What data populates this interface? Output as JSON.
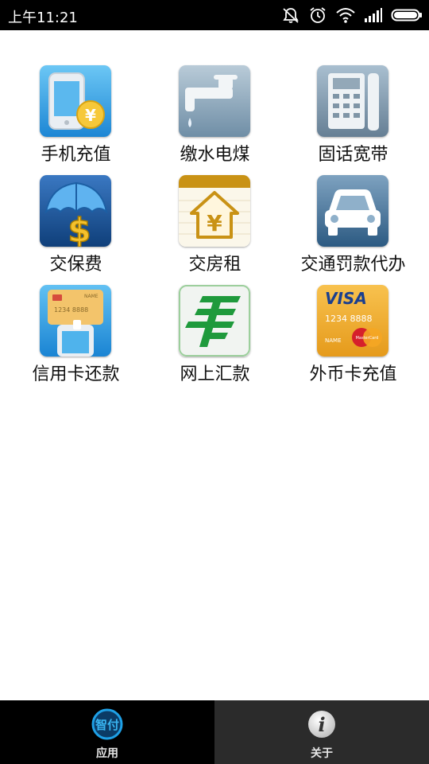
{
  "status_bar": {
    "time": "上午11:21",
    "icons": [
      "mute-icon",
      "alarm-icon",
      "wifi-icon",
      "signal-icon",
      "battery-icon"
    ]
  },
  "grid": {
    "items": [
      {
        "label": "手机充值",
        "icon": "mobile-recharge-icon"
      },
      {
        "label": "缴水电煤",
        "icon": "water-tap-icon"
      },
      {
        "label": "固话宽带",
        "icon": "landline-phone-icon"
      },
      {
        "label": "交保费",
        "icon": "insurance-umbrella-icon"
      },
      {
        "label": "交房租",
        "icon": "house-rent-icon"
      },
      {
        "label": "交通罚款代办",
        "icon": "car-icon"
      },
      {
        "label": "信用卡还款",
        "icon": "credit-card-phone-icon"
      },
      {
        "label": "网上汇款",
        "icon": "china-post-icon"
      },
      {
        "label": "外币卡充值",
        "icon": "visa-card-icon"
      }
    ],
    "icon_texts": {
      "coin": "¥",
      "house": "¥",
      "dollar": "$",
      "visa_brand": "VISA",
      "visa_number": "1234 8888",
      "visa_name": "NAME",
      "mastercard": "MasterCard",
      "cc_number": "1234 8888",
      "cc_name": "NAME"
    }
  },
  "bottom_nav": {
    "tabs": [
      {
        "label": "应用",
        "icon_text": "智付",
        "active": true
      },
      {
        "label": "关于",
        "icon_text": "i",
        "active": false
      }
    ]
  },
  "colors": {
    "status_bar_bg": "#000000",
    "page_bg": "#ffffff",
    "nav_active_bg": "#000000",
    "nav_inactive_bg": "#2b2b2b",
    "brand_blue": "#1ea0e6"
  }
}
